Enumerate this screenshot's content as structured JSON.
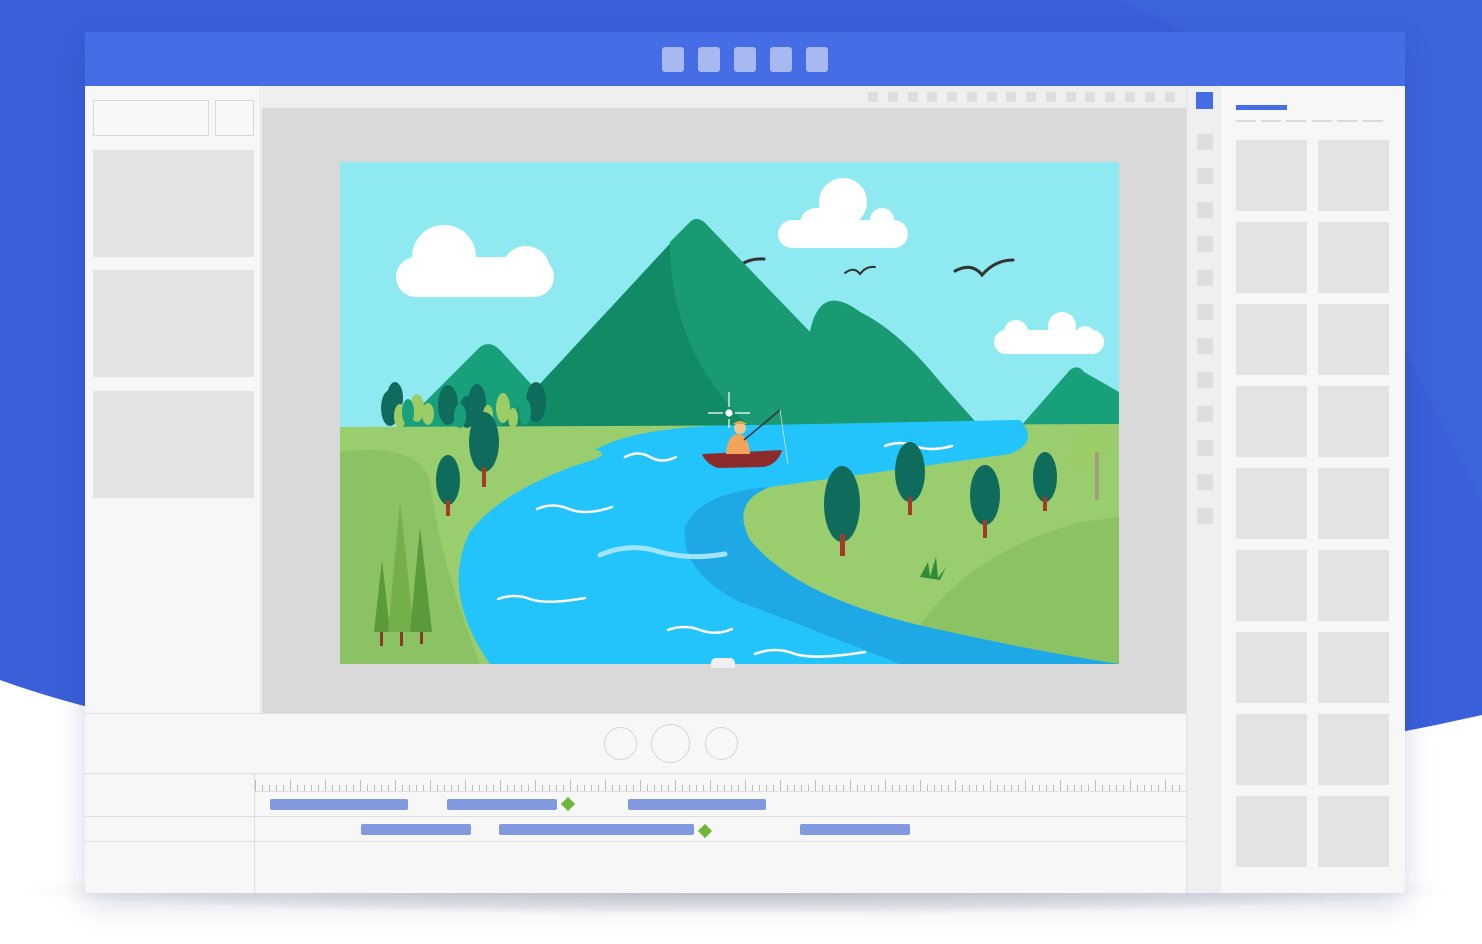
{
  "app": {
    "name": "",
    "accent_color": "#466de6",
    "background_color": "#3a5fd9",
    "clip_color": "#8199df",
    "keyframe_color": "#6fb63c"
  },
  "titlebar": {
    "buttons": [
      "toolbar-item-1",
      "toolbar-item-2",
      "toolbar-item-3",
      "toolbar-item-4",
      "toolbar-item-5"
    ]
  },
  "left_panel": {
    "search_value": "",
    "thumbnails": 3
  },
  "canvas": {
    "scene": "landscape",
    "icons": [
      "cloud-icon",
      "bird-icon",
      "mountain-icon",
      "tree-icon",
      "river-icon",
      "boat-icon",
      "fisherman-icon",
      "crosshair-icon"
    ]
  },
  "controls": {
    "buttons": [
      "previous-button",
      "play-button",
      "next-button"
    ]
  },
  "timeline": {
    "tracks": [
      {
        "clips": 3,
        "keyframes": 1
      },
      {
        "clips": 3,
        "keyframes": 1
      }
    ]
  },
  "right_panel": {
    "tools": 12,
    "tabs": 6,
    "tiles": 18
  }
}
